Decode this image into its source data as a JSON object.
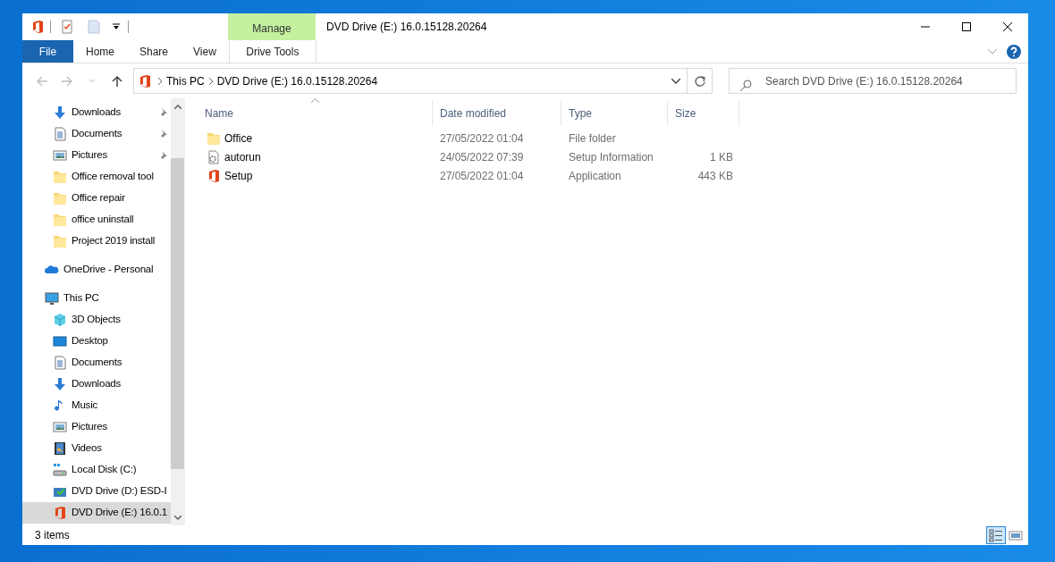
{
  "window": {
    "title": "DVD Drive (E:) 16.0.15128.20264"
  },
  "ribbon": {
    "file_tab": "File",
    "tabs": [
      "Home",
      "Share",
      "View"
    ],
    "contextual": {
      "group": "Manage",
      "tabs": [
        "Drive Tools"
      ]
    }
  },
  "address_bar": {
    "crumbs": [
      "This PC",
      "DVD Drive (E:) 16.0.15128.20264"
    ]
  },
  "search": {
    "placeholder": "Search DVD Drive (E:) 16.0.15128.20264"
  },
  "sidebar": {
    "quick_access_items": [
      {
        "label": "Downloads",
        "kind": "downloads",
        "pinned": true,
        "selected": false
      },
      {
        "label": "Documents",
        "kind": "documents",
        "pinned": true,
        "selected": false
      },
      {
        "label": "Pictures",
        "kind": "pictures",
        "pinned": true,
        "selected": false
      },
      {
        "label": "Office removal tool",
        "kind": "folder",
        "pinned": false,
        "selected": false
      },
      {
        "label": "Office repair",
        "kind": "folder",
        "pinned": false,
        "selected": false
      },
      {
        "label": "office uninstall",
        "kind": "folder",
        "pinned": false,
        "selected": false
      },
      {
        "label": "Project 2019 install",
        "kind": "folder",
        "pinned": false,
        "selected": false
      }
    ],
    "items": [
      {
        "label": "OneDrive - Personal",
        "kind": "cloud",
        "selected": false
      },
      {
        "label": "This PC",
        "kind": "pc",
        "selected": false,
        "children": [
          {
            "label": "3D Objects",
            "kind": "cube",
            "selected": false
          },
          {
            "label": "Desktop",
            "kind": "desktop",
            "selected": false
          },
          {
            "label": "Documents",
            "kind": "documents",
            "selected": false
          },
          {
            "label": "Downloads",
            "kind": "downloads",
            "selected": false
          },
          {
            "label": "Music",
            "kind": "music",
            "selected": false
          },
          {
            "label": "Pictures",
            "kind": "pictures",
            "selected": false
          },
          {
            "label": "Videos",
            "kind": "videos",
            "selected": false
          },
          {
            "label": "Local Disk (C:)",
            "kind": "disk",
            "selected": false
          },
          {
            "label": "DVD Drive (D:) ESD-I",
            "kind": "dvd",
            "selected": false
          },
          {
            "label": "DVD Drive (E:) 16.0.1",
            "kind": "office",
            "selected": true
          }
        ]
      }
    ]
  },
  "table": {
    "columns": [
      "Name",
      "Date modified",
      "Type",
      "Size"
    ],
    "rows": [
      {
        "name": "Office",
        "date": "27/05/2022 01:04",
        "type": "File folder",
        "size": "",
        "kind": "folder"
      },
      {
        "name": "autorun",
        "date": "24/05/2022 07:39",
        "type": "Setup Information",
        "size": "1 KB",
        "kind": "settings"
      },
      {
        "name": "Setup",
        "date": "27/05/2022 01:04",
        "type": "Application",
        "size": "443 KB",
        "kind": "office"
      }
    ]
  },
  "status_bar": {
    "text": "3 items",
    "views": [
      {
        "kind": "details",
        "selected": true
      },
      {
        "kind": "large",
        "selected": false
      }
    ]
  }
}
